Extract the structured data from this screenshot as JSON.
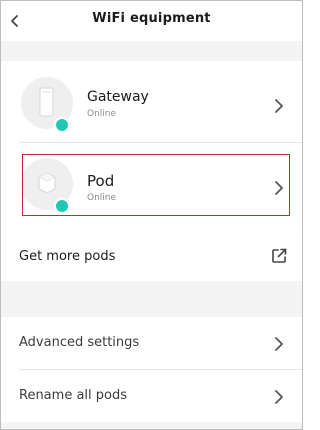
{
  "header": {
    "title": "WiFi equipment",
    "back_icon": "chevron-left-icon"
  },
  "devices": [
    {
      "name": "Gateway",
      "status": "Online",
      "icon": "gateway-device-icon",
      "status_color": "#21c7b3"
    },
    {
      "name": "Pod",
      "status": "Online",
      "icon": "pod-device-icon",
      "status_color": "#21c7b3",
      "highlighted": true
    }
  ],
  "get_more_pods": {
    "label": "Get more pods",
    "icon": "external-link-icon"
  },
  "settings": {
    "items": [
      {
        "label": "Advanced settings",
        "icon": "chevron-right-icon"
      },
      {
        "label": "Rename all pods",
        "icon": "chevron-right-icon"
      }
    ]
  },
  "colors": {
    "accent": "#21c7b3",
    "highlight_border": "#c62828",
    "section_background": "#f4f4f4"
  }
}
